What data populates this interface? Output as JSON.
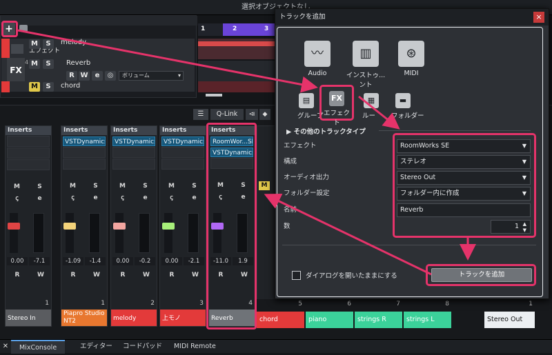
{
  "window": {
    "title": "選択オブジェクトなし"
  },
  "toolbar": {
    "add_label": "+"
  },
  "tracks": [
    {
      "type": "",
      "name": "melody",
      "label_extra": "エフェクト",
      "num": ""
    },
    {
      "type": "FX",
      "name": "Reverb",
      "num": "4",
      "volume_label": "ボリューム"
    },
    {
      "type": "",
      "name": "chord",
      "num": "5"
    }
  ],
  "ruler": {
    "m1": "1",
    "m2": "2",
    "m3": "3"
  },
  "mix_toolbar": {
    "qlink": "Q-Link"
  },
  "strips": [
    {
      "insert": "Inserts",
      "plugins": [],
      "m": "M",
      "s": "S",
      "val1": "0.00",
      "val2": "-7.1",
      "r": "R",
      "w": "W",
      "num": "1",
      "name": "Stereo In",
      "color": "#5a5c60",
      "fader": "#e04444"
    },
    {
      "insert": "Inserts",
      "plugins": [
        "VSTDynamics"
      ],
      "m": "M",
      "s": "S",
      "val1": "-1.09",
      "val2": "-1.4",
      "r": "R",
      "w": "W",
      "num": "1",
      "name": "Piapro Studio NT2",
      "color": "#e8772f",
      "fader": "#f3d37a"
    },
    {
      "insert": "Inserts",
      "plugins": [
        "VSTDynamics"
      ],
      "m": "M",
      "s": "S",
      "val1": "0.00",
      "val2": "-0.2",
      "r": "R",
      "w": "W",
      "num": "2",
      "name": "melody",
      "color": "#e33a3a",
      "fader": "#f3a6a0"
    },
    {
      "insert": "Inserts",
      "plugins": [
        "VSTDynamics"
      ],
      "m": "M",
      "s": "S",
      "val1": "0.00",
      "val2": "-2.1",
      "r": "R",
      "w": "W",
      "num": "3",
      "name": "上モノ",
      "color": "#e33a3a",
      "fader": "#a8f07a"
    },
    {
      "insert": "Inserts",
      "plugins": [
        "RoomWor...SE",
        "VSTDynamics"
      ],
      "m": "M",
      "s": "S",
      "val1": "-11.0",
      "val2": "1.9",
      "r": "R",
      "w": "W",
      "num": "4",
      "name": "Reverb",
      "color": "#6f7378",
      "fader": "#b168f5"
    }
  ],
  "lanes": [
    {
      "num": "5",
      "name": "chord",
      "color": "#e33a3a"
    },
    {
      "num": "6",
      "name": "piano",
      "color": "#3bd29a"
    },
    {
      "num": "7",
      "name": "strings R",
      "color": "#3bd29a"
    },
    {
      "num": "8",
      "name": "strings L",
      "color": "#3bd29a"
    },
    {
      "num": "1",
      "name": "Stereo Out",
      "color": "#eceff2"
    }
  ],
  "dialog": {
    "title": "トラックを追加",
    "close": "×",
    "big_types": [
      {
        "label": "Audio",
        "icon": "audio-wave-icon"
      },
      {
        "label": "インストゥ...ント",
        "icon": "keyboard-icon"
      },
      {
        "label": "MIDI",
        "icon": "midi-port-icon"
      }
    ],
    "small_types": [
      {
        "label": "グループ",
        "icon": "group-icon"
      },
      {
        "label": "エフェクト",
        "icon": "fx-icon"
      },
      {
        "label": "ルー",
        "icon": "ruler-icon"
      },
      {
        "label": "フォルダー",
        "icon": "folder-icon"
      }
    ],
    "other_types": "その他のトラックタイプ",
    "fields": [
      {
        "label": "エフェクト",
        "value": "RoomWorks SE"
      },
      {
        "label": "構成",
        "value": "ステレオ"
      },
      {
        "label": "オーディオ出力",
        "value": "Stereo Out"
      },
      {
        "label": "フォルダー設定",
        "value": "フォルダー内に作成"
      }
    ],
    "name_label": "名前",
    "name_value": "Reverb",
    "count_label": "数",
    "count_value": "1",
    "keep_open": "ダイアログを開いたままにする",
    "add_button": "トラックを追加"
  },
  "bottom_tabs": [
    "MixConsole",
    "エディター",
    "コードパッド",
    "MIDI Remote"
  ],
  "colors": {
    "accent": "#e5336a",
    "plugin": "#17577a",
    "fx_selected": "#8d9196"
  }
}
